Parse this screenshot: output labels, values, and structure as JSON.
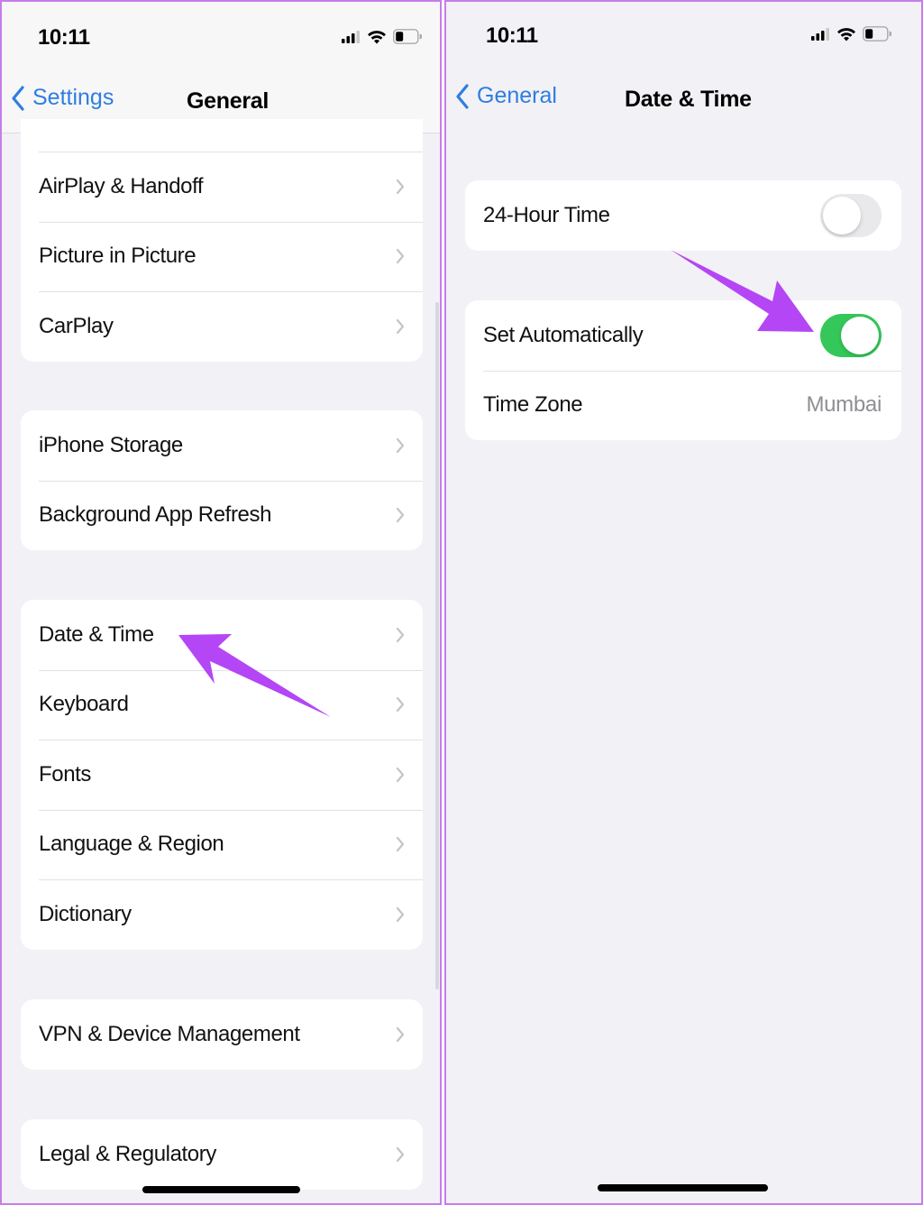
{
  "left_screen": {
    "status_bar": {
      "time": "10:11",
      "icons": [
        "cellular-signal-icon",
        "wifi-icon",
        "battery-icon"
      ]
    },
    "nav": {
      "back_label": "Settings",
      "title": "General"
    },
    "groups": [
      {
        "items": [
          {
            "label": "AirPlay & Handoff"
          },
          {
            "label": "Picture in Picture"
          },
          {
            "label": "CarPlay"
          }
        ]
      },
      {
        "items": [
          {
            "label": "iPhone Storage"
          },
          {
            "label": "Background App Refresh"
          }
        ]
      },
      {
        "items": [
          {
            "label": "Date & Time"
          },
          {
            "label": "Keyboard"
          },
          {
            "label": "Fonts"
          },
          {
            "label": "Language & Region"
          },
          {
            "label": "Dictionary"
          }
        ]
      },
      {
        "items": [
          {
            "label": "VPN & Device Management"
          }
        ]
      },
      {
        "items": [
          {
            "label": "Legal & Regulatory"
          }
        ]
      }
    ],
    "annotation": {
      "type": "arrow",
      "points_to": "Date & Time"
    }
  },
  "right_screen": {
    "status_bar": {
      "time": "10:11",
      "icons": [
        "cellular-signal-icon",
        "wifi-icon",
        "battery-icon"
      ]
    },
    "nav": {
      "back_label": "General",
      "title": "Date & Time"
    },
    "settings": {
      "hour24": {
        "label": "24-Hour Time",
        "enabled": false
      },
      "set_automatically": {
        "label": "Set Automatically",
        "enabled": true
      },
      "time_zone": {
        "label": "Time Zone",
        "value": "Mumbai"
      }
    },
    "annotation": {
      "type": "arrow",
      "points_to": "Set Automatically toggle"
    }
  },
  "colors": {
    "accent_blue": "#2f7de1",
    "toggle_on": "#34c759",
    "toggle_off": "#e9e9eb",
    "annotation_purple": "#b446f5",
    "panel_border": "#c77dea",
    "background": "#f2f1f6"
  }
}
